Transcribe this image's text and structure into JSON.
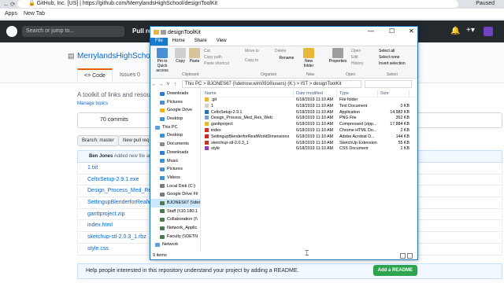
{
  "browser": {
    "tab_title": "GitHub, Inc. [US]",
    "url": "https://github.com/MerrylandsHighSchool/designToolKit",
    "bookmarks": [
      "Apps",
      "New Tab"
    ],
    "profile": "Paused"
  },
  "github": {
    "search_placeholder": "Search or jump to...",
    "pull_label": "Pull re",
    "repo_title": "MerrylandsHighSchool",
    "tabs": [
      {
        "label": "<> Code",
        "active": true
      },
      {
        "label": "Issues 0",
        "active": false
      },
      {
        "label": "P",
        "active": false
      }
    ],
    "description": "A toolkit of links and resourc",
    "manage_topics": "Manage topics",
    "commits": "70 commits",
    "branch": "Branch: master",
    "new_pull": "New pull req",
    "commit_author": "Ben Jones",
    "commit_msg": "Added new file and",
    "files": [
      "1.txt",
      "CeltxSetup-2.9.1.exe",
      "Design_Process_Med_Res_W",
      "SettingupBlenderforRealWo",
      "ganttproject.zip",
      "index.html",
      "sketchup-stl-2.0.3_1.rbz",
      "style.css"
    ],
    "readme_text": "Help people interested in this repository understand your project by adding a README.",
    "readme_button": "Add a README"
  },
  "explorer": {
    "title": "designToolKit",
    "ribbon_tabs": [
      "File",
      "Home",
      "Share",
      "View"
    ],
    "ribbon": {
      "pin": "Pin to Quick access",
      "copy": "Copy",
      "paste": "Paste",
      "cut": "Cut",
      "copy_path": "Copy path",
      "paste_shortcut": "Paste shortcut",
      "move_to": "Move to",
      "copy_to": "Copy to",
      "delete": "Delete",
      "rename": "Rename",
      "new_folder": "New folder",
      "properties": "Properties",
      "open": "Open",
      "edit": "Edit",
      "history": "History",
      "select_all": "Select all",
      "select_none": "Select none",
      "invert_selection": "Invert selection",
      "groups": [
        "Clipboard",
        "Organize",
        "New",
        "Open",
        "Select"
      ]
    },
    "path": "This PC  >  BJONES67 (\\\\detnsw.win\\0916\\users) (K:)  >  IST  >  designToolKit",
    "nav": [
      {
        "label": "Downloads",
        "color": "#2b7bd6",
        "sel": false
      },
      {
        "label": "Pictures",
        "color": "#4a8fd6",
        "sel": false
      },
      {
        "label": "Google Drive",
        "color": "#f4b400",
        "sel": false
      },
      {
        "label": "Desktop",
        "color": "#3c8fd8",
        "sel": false
      },
      {
        "label": "This PC",
        "color": "#5aa0e0",
        "sel": false
      },
      {
        "label": "Desktop",
        "color": "#3c8fd8",
        "sel": false
      },
      {
        "label": "Documents",
        "color": "#8a8a8a",
        "sel": false
      },
      {
        "label": "Downloads",
        "color": "#2b7bd6",
        "sel": false
      },
      {
        "label": "Music",
        "color": "#3c8fd8",
        "sel": false
      },
      {
        "label": "Pictures",
        "color": "#4a8fd6",
        "sel": false
      },
      {
        "label": "Videos",
        "color": "#3c8fd8",
        "sel": false
      },
      {
        "label": "Local Disk (C:)",
        "color": "#7a7a7a",
        "sel": false
      },
      {
        "label": "Google Drive Fil",
        "color": "#7a7a7a",
        "sel": false
      },
      {
        "label": "BJONES67 (\\\\det",
        "color": "#4c7a4c",
        "sel": true
      },
      {
        "label": "Staff (\\\\10.180.1",
        "color": "#4c7a4c",
        "sel": false
      },
      {
        "label": "Collaboration (\\\\",
        "color": "#4c7a4c",
        "sel": false
      },
      {
        "label": "Network_Applic",
        "color": "#4c7a4c",
        "sel": false
      },
      {
        "label": "Faculty (\\\\DETN",
        "color": "#4c7a4c",
        "sel": false
      },
      {
        "label": "Network",
        "color": "#5aa0e0",
        "sel": false
      }
    ],
    "columns": [
      "Name",
      "Date modified",
      "Type",
      "Size"
    ],
    "files": [
      {
        "name": ".git",
        "date": "6/18/2019 11:10 AM",
        "type": "File folder",
        "size": "",
        "color": "#e8b73a"
      },
      {
        "name": "1",
        "date": "6/18/2019 11:10 AM",
        "type": "Text Document",
        "size": "0 KB",
        "color": "#d0d0d0"
      },
      {
        "name": "CeltxSetup-2.9.1",
        "date": "6/18/2019 11:10 AM",
        "type": "Application",
        "size": "14,982 KB",
        "color": "#2d6fb8"
      },
      {
        "name": "Design_Process_Med_Res_Web",
        "date": "6/18/2019 11:10 AM",
        "type": "PNG File",
        "size": "352 KB",
        "color": "#7a9fd0"
      },
      {
        "name": "ganttproject",
        "date": "6/18/2019 11:10 AM",
        "type": "Compressed (zipp...",
        "size": "17,884 KB",
        "color": "#e8b73a"
      },
      {
        "name": "index",
        "date": "6/18/2019 11:10 AM",
        "type": "Chrome HTML Do...",
        "size": "2 KB",
        "color": "#d93025"
      },
      {
        "name": "SettingupBlenderforRealWorldDimensions",
        "date": "6/18/2019 11:10 AM",
        "type": "Adobe Acrobat D...",
        "size": "144 KB",
        "color": "#c62828"
      },
      {
        "name": "sketchup-stl-2.0.3_1",
        "date": "6/18/2019 11:10 AM",
        "type": "SketchUp Extension",
        "size": "55 KB",
        "color": "#c0392b"
      },
      {
        "name": "style",
        "date": "6/18/2019 11:10 AM",
        "type": "CSS Document",
        "size": "1 KB",
        "color": "#8e44ad"
      }
    ],
    "status": "9 items"
  }
}
